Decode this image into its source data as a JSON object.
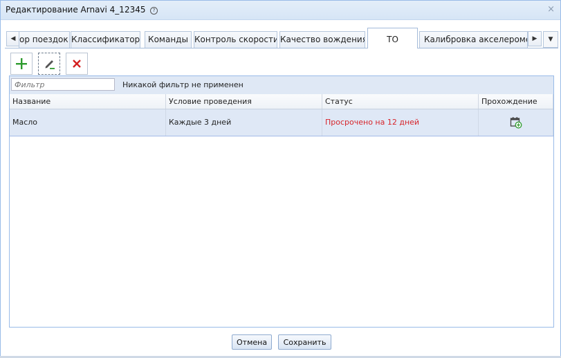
{
  "window": {
    "title": "Редактирование Arnavi 4_12345",
    "help_glyph": "?",
    "close_glyph": "×"
  },
  "tabs": {
    "scroll_left_glyph": "◀",
    "scroll_right_glyph": "▶",
    "menu_glyph": "▼",
    "items": [
      {
        "label": "ор поездок"
      },
      {
        "label": "Классификатор"
      },
      {
        "label": "Команды"
      },
      {
        "label": "Контроль скорости"
      },
      {
        "label": "Качество вождения"
      },
      {
        "label": "ТО"
      },
      {
        "label": "Калибровка акселерометра"
      }
    ],
    "active": "ТО"
  },
  "toolbar": {
    "add_icon": "plus-icon",
    "edit_icon": "pencil-icon",
    "delete_icon": "delete-x-icon"
  },
  "filter": {
    "placeholder": "Фильтр",
    "status": "Никакой фильтр не применен"
  },
  "grid": {
    "columns": [
      "Название",
      "Условие проведения",
      "Статус",
      "Прохождение"
    ],
    "rows": [
      {
        "name": "Масло",
        "condition": "Каждые 3 дней",
        "status": "Просрочено на 12 дней",
        "pass_icon": "calendar-add-icon"
      }
    ]
  },
  "footer": {
    "cancel_label": "Отмена",
    "save_label": "Сохранить"
  },
  "colors": {
    "accent_border": "#99bbe8",
    "status_overdue": "#d7252b",
    "add_green": "#2e9b2e",
    "delete_red": "#d42020",
    "selected_row": "#dfe8f6"
  }
}
